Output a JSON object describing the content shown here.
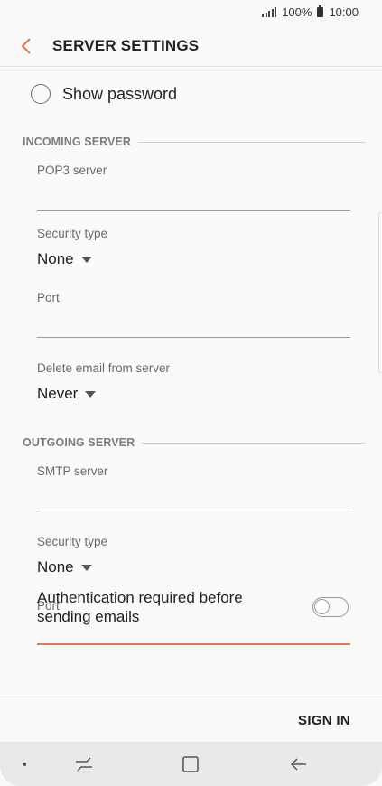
{
  "status_bar": {
    "battery": "100%",
    "time": "10:00",
    "icons": [
      "signal-icon",
      "battery-icon"
    ]
  },
  "app_bar": {
    "title": "SERVER SETTINGS",
    "back_icon": "chevron-left-icon",
    "accent_color": "#e27a4a"
  },
  "show_password": {
    "label": "Show password",
    "checked": false
  },
  "incoming": {
    "section_title": "INCOMING SERVER",
    "server_label": "POP3 server",
    "server_value": "",
    "security_label": "Security type",
    "security_value": "None",
    "port_label": "Port",
    "port_value": "",
    "delete_label": "Delete email from server",
    "delete_value": "Never"
  },
  "outgoing": {
    "section_title": "OUTGOING SERVER",
    "server_label": "SMTP server",
    "server_value": "",
    "security_label": "Security type",
    "security_value": "None",
    "port_label": "Port",
    "port_value": "",
    "auth_label": "Authentication required before sending emails",
    "auth_enabled": false
  },
  "bottom_bar": {
    "sign_in_label": "SIGN IN"
  },
  "nav_bar": {
    "items": [
      "dot-icon",
      "recent-apps-icon",
      "home-icon",
      "back-arrow-icon"
    ]
  }
}
